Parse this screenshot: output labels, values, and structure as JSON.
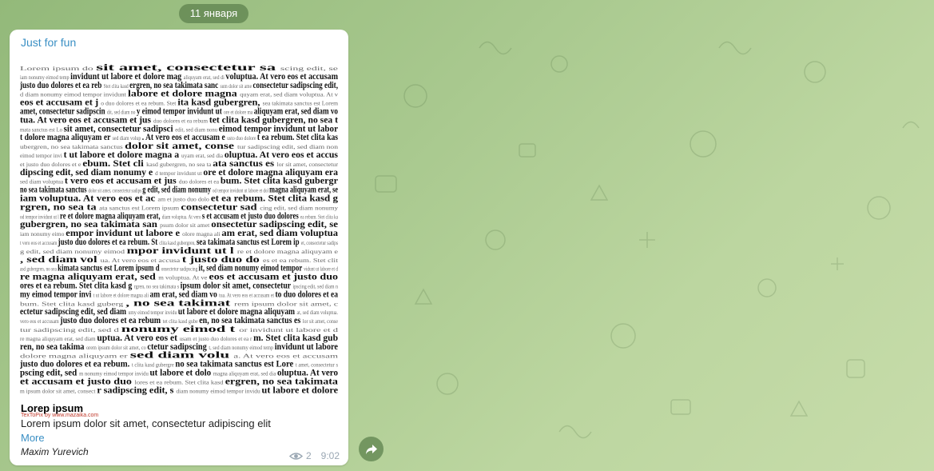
{
  "chat": {
    "date_label": "11 января"
  },
  "post": {
    "channel_name": "Just for fun",
    "image": {
      "caption_watermark": "TexToPix by www.mazaika.com",
      "dense_line": "Lorem ipsum dolor sit amet, consectetur sadipscing edit, sed diam nonumy eimod tempor invidunt ut labore et dolore magna aliquyam erat, sed diam voluptua. At vero eos et accusam et justo duo dolores et ea rebum. Stet clita kasd gubergren, no sea takimata sanctus est Lorem ipsum dolor sit amet."
    },
    "title": "Lorep ipsum",
    "body": "Lorem ipsum dolor sit amet, consectetur adipiscing elit",
    "more_label": "More",
    "author": "Maxim Yurevich",
    "views": "2",
    "time": "9:02"
  },
  "icons": {
    "views": "eye-icon",
    "share": "share-arrow-icon"
  },
  "colors": {
    "link": "#3a8fc4",
    "pill": "#5e824e",
    "meta": "#9aa7b3"
  }
}
